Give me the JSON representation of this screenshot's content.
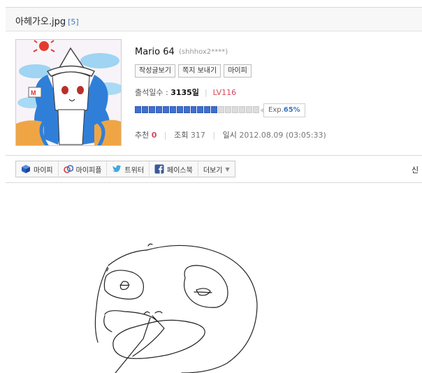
{
  "post": {
    "title": "아헤가오.jpg",
    "comment_count": "[5]"
  },
  "profile": {
    "nickname": "Mario 64",
    "user_id": "(shhhox2****)",
    "buttons": [
      "작성글보기",
      "쪽지 보내기",
      "마이피"
    ],
    "attendance_label": "출석일수 : ",
    "attendance_value": "3135일",
    "level": "LV116",
    "exp_label": "Exp.",
    "exp_value": "65%",
    "exp_progress": 0.65
  },
  "stats": {
    "recommend_label": "추천",
    "recommend_value": "0",
    "views_label": "조회",
    "views_value": "317",
    "date_label": "일시",
    "date_value": "2012.08.09 (03:05:33)"
  },
  "share": {
    "items": [
      {
        "label": "마이피",
        "icon": "cube-icon"
      },
      {
        "label": "마이피플",
        "icon": "mypeople-icon"
      },
      {
        "label": "트위터",
        "icon": "twitter-bird-icon"
      },
      {
        "label": "페이스북",
        "icon": "facebook-icon"
      },
      {
        "label": "더보기",
        "icon": "caret-down-icon"
      }
    ],
    "report_label": "신"
  },
  "colors": {
    "accent_blue": "#3b77c4",
    "level_red": "#d5475c",
    "exp_fill": "#3f6fd0"
  }
}
